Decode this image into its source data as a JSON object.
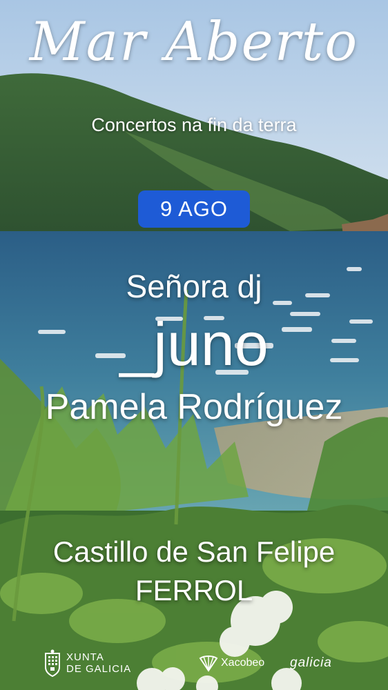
{
  "poster": {
    "title": "Mar Aberto",
    "subtitle": "Concertos na fin da terra",
    "date": "9 AGO",
    "artists": [
      "Señora dj",
      "_juno",
      "Pamela Rodríguez"
    ],
    "venue": "Castillo de San Felipe",
    "city": "FERROL",
    "badge_color": "#1e5bd6"
  },
  "footer": {
    "xunta_line1": "XUNTA",
    "xunta_line2": "DE GALICIA",
    "xacobeo": "Xacobeo",
    "galicia": "galicia"
  },
  "icons": [
    "xunta-crest-icon",
    "xacobeo-shell-icon"
  ]
}
